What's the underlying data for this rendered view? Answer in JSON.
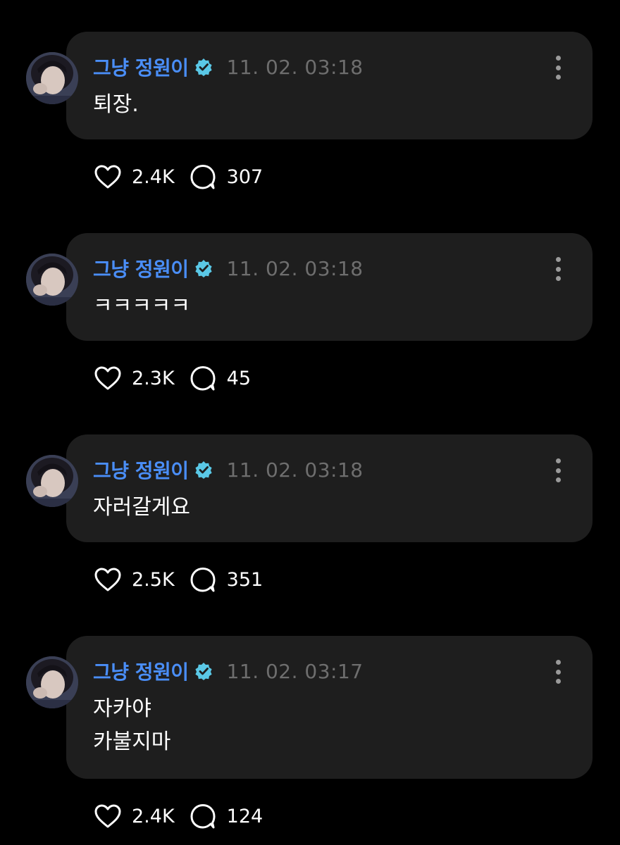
{
  "colors": {
    "background": "#000000",
    "card": "#1e1e1e",
    "username": "#4a8ef7",
    "verified_badge": "#5ac8e6",
    "timestamp": "#6e6e6e"
  },
  "icons": {
    "like": "heart-icon",
    "comment": "speech-bubble-icon",
    "more": "vertical-ellipsis-icon",
    "verified": "verified-badge-icon"
  },
  "posts": [
    {
      "username": "그냥 정원이",
      "timestamp": "11. 02. 03:18",
      "lines": [
        "퇴장."
      ],
      "likes": "2.4K",
      "comments": "307"
    },
    {
      "username": "그냥 정원이",
      "timestamp": "11. 02. 03:18",
      "lines": [
        "ㅋㅋㅋㅋㅋ"
      ],
      "likes": "2.3K",
      "comments": "45"
    },
    {
      "username": "그냥 정원이",
      "timestamp": "11. 02. 03:18",
      "lines": [
        "자러갈게요"
      ],
      "likes": "2.5K",
      "comments": "351"
    },
    {
      "username": "그냥 정원이",
      "timestamp": "11. 02. 03:17",
      "lines": [
        "자카야",
        "카불지마"
      ],
      "likes": "2.4K",
      "comments": "124"
    }
  ]
}
